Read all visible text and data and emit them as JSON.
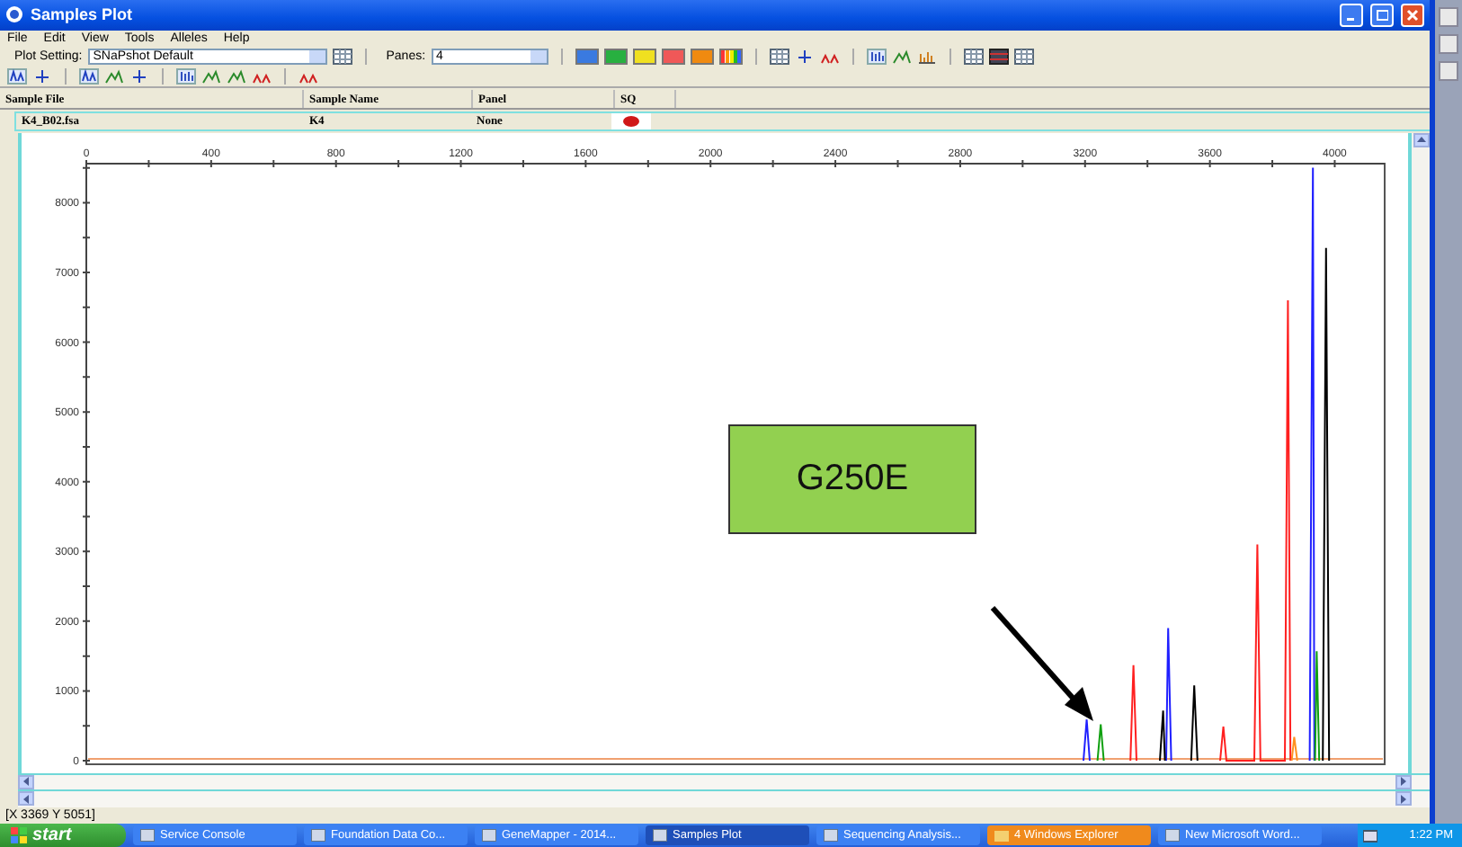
{
  "window": {
    "title": "Samples Plot"
  },
  "menu": [
    "File",
    "Edit",
    "View",
    "Tools",
    "Alleles",
    "Help"
  ],
  "toolbar": {
    "plot_setting_label": "Plot Setting:",
    "plot_setting": "SNaPshot Default",
    "panes_label": "Panes:",
    "panes": "4",
    "dye_buttons": [
      {
        "color": "#3a7ae0"
      },
      {
        "color": "#28b040"
      },
      {
        "color": "#f0e020"
      },
      {
        "color": "#f05858"
      },
      {
        "color": "#f08a10"
      }
    ]
  },
  "table": {
    "columns": [
      "Sample File",
      "Sample Name",
      "Panel",
      "SQ"
    ],
    "rows": [
      {
        "cells": [
          "K4_B02.fsa",
          "K4",
          "None"
        ]
      }
    ]
  },
  "plot": {
    "chart_data": {
      "type": "line",
      "xlim": [
        0,
        4160
      ],
      "ylim": [
        0,
        8560
      ],
      "xticks": [
        0,
        400,
        800,
        1200,
        1600,
        2000,
        2400,
        2800,
        3200,
        3600,
        4000
      ],
      "yticks": [
        0,
        1000,
        2000,
        3000,
        4000,
        5000,
        6000,
        7000,
        8000
      ],
      "x": [
        3195,
        3205,
        3215,
        3240,
        3250,
        3260,
        3345,
        3355,
        3365,
        3440,
        3450,
        3456,
        3460,
        3466,
        3476,
        3540,
        3550,
        3560,
        3633,
        3643,
        3653,
        3742,
        3752,
        3762,
        3840,
        3850,
        3858,
        3862,
        3870,
        3880,
        3920,
        3930,
        3935,
        3937,
        3942,
        3950,
        3962,
        3972,
        3982
      ],
      "series": [
        {
          "color": "#2020ff",
          "values": [
            0,
            590,
            0,
            null,
            null,
            null,
            null,
            null,
            null,
            null,
            null,
            null,
            0,
            1900,
            0,
            null,
            null,
            null,
            null,
            null,
            null,
            null,
            null,
            null,
            null,
            null,
            null,
            null,
            null,
            null,
            0,
            8500,
            0,
            null,
            null,
            null,
            null,
            null,
            null
          ]
        },
        {
          "color": "#10a010",
          "values": [
            null,
            null,
            null,
            0,
            520,
            0,
            null,
            null,
            null,
            null,
            null,
            null,
            null,
            null,
            null,
            null,
            null,
            null,
            null,
            null,
            null,
            null,
            null,
            null,
            null,
            null,
            null,
            null,
            null,
            null,
            null,
            null,
            null,
            0,
            1570,
            0,
            null,
            null,
            null
          ]
        },
        {
          "color": "#000000",
          "values": [
            null,
            null,
            null,
            null,
            null,
            null,
            null,
            null,
            null,
            0,
            720,
            0,
            null,
            null,
            null,
            0,
            1080,
            0,
            null,
            null,
            null,
            null,
            null,
            null,
            null,
            null,
            null,
            null,
            null,
            null,
            null,
            null,
            null,
            null,
            null,
            null,
            0,
            7350,
            0
          ]
        },
        {
          "color": "#ff2020",
          "values": [
            null,
            null,
            null,
            null,
            null,
            null,
            0,
            1370,
            0,
            null,
            null,
            null,
            null,
            null,
            null,
            null,
            null,
            null,
            0,
            490,
            0,
            0,
            3100,
            0,
            0,
            6600,
            0,
            null,
            null,
            null,
            null,
            null,
            null,
            null,
            null,
            null,
            null,
            null,
            null
          ]
        },
        {
          "color": "#ff9020",
          "values": [
            null,
            null,
            null,
            null,
            null,
            null,
            null,
            null,
            null,
            null,
            null,
            null,
            null,
            null,
            null,
            null,
            null,
            null,
            null,
            null,
            null,
            null,
            null,
            null,
            null,
            null,
            null,
            0,
            340,
            0,
            null,
            null,
            null,
            null,
            null,
            null,
            null,
            null,
            null
          ]
        }
      ]
    },
    "callout": {
      "text": "G250E"
    }
  },
  "status_bar": "[X 3369  Y 5051]",
  "taskbar": {
    "start": "start",
    "clock": "1:22 PM",
    "tasks": [
      {
        "label": "Service Console",
        "selected": false,
        "kind": "app"
      },
      {
        "label": "Foundation Data Co...",
        "selected": false,
        "kind": "app"
      },
      {
        "label": "GeneMapper - 2014...",
        "selected": false,
        "kind": "app"
      },
      {
        "label": "Samples Plot",
        "selected": true,
        "kind": "app"
      },
      {
        "label": "Sequencing Analysis...",
        "selected": false,
        "kind": "app"
      },
      {
        "label": "4 Windows Explorer",
        "selected": false,
        "kind": "group"
      },
      {
        "label": "New Microsoft Word...",
        "selected": false,
        "kind": "app"
      }
    ]
  }
}
